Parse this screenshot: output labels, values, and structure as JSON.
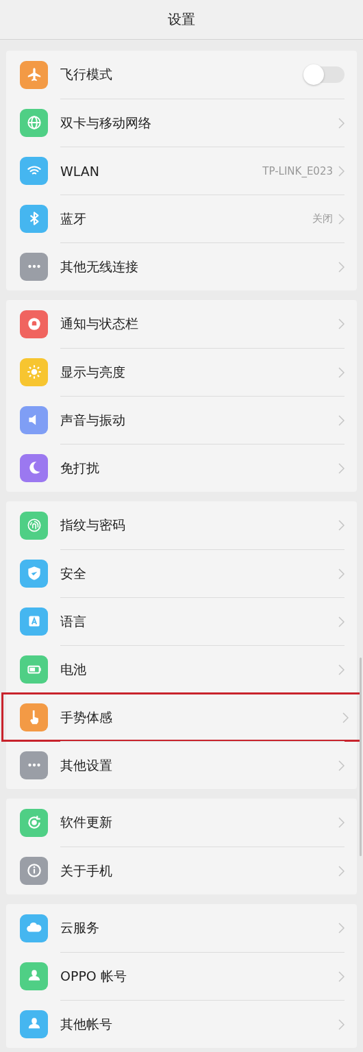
{
  "header": {
    "title": "设置"
  },
  "groups": [
    {
      "items": [
        {
          "label": "飞行模式",
          "kind": "toggle",
          "on": false,
          "color": "#f39a45"
        },
        {
          "label": "双卡与移动网络",
          "kind": "link",
          "color": "#4fcf85"
        },
        {
          "label": "WLAN",
          "kind": "link",
          "value": "TP-LINK_E023",
          "color": "#45b6f0"
        },
        {
          "label": "蓝牙",
          "kind": "link",
          "value": "关闭",
          "color": "#45b6f0"
        },
        {
          "label": "其他无线连接",
          "kind": "link",
          "color": "#9a9ea6"
        }
      ]
    },
    {
      "items": [
        {
          "label": "通知与状态栏",
          "kind": "link",
          "color": "#f0645f"
        },
        {
          "label": "显示与亮度",
          "kind": "link",
          "color": "#f7c530"
        },
        {
          "label": "声音与振动",
          "kind": "link",
          "color": "#7f9ef5"
        },
        {
          "label": "免打扰",
          "kind": "link",
          "color": "#9b78f0"
        }
      ]
    },
    {
      "items": [
        {
          "label": "指纹与密码",
          "kind": "link",
          "color": "#4fcf85"
        },
        {
          "label": "安全",
          "kind": "link",
          "color": "#45b6f0"
        },
        {
          "label": "语言",
          "kind": "link",
          "color": "#45b6f0"
        },
        {
          "label": "电池",
          "kind": "link",
          "color": "#4fcf85"
        },
        {
          "label": "手势体感",
          "kind": "link",
          "highlighted": true,
          "color": "#f39a45"
        },
        {
          "label": "其他设置",
          "kind": "link",
          "color": "#9a9ea6"
        }
      ]
    },
    {
      "items": [
        {
          "label": "软件更新",
          "kind": "link",
          "color": "#4fcf85"
        },
        {
          "label": "关于手机",
          "kind": "link",
          "color": "#9a9ea6"
        }
      ]
    },
    {
      "items": [
        {
          "label": "云服务",
          "kind": "link",
          "color": "#45b6f0"
        },
        {
          "label": "OPPO 帐号",
          "kind": "link",
          "color": "#4fcf85"
        },
        {
          "label": "其他帐号",
          "kind": "link",
          "color": "#45b6f0"
        }
      ]
    }
  ]
}
